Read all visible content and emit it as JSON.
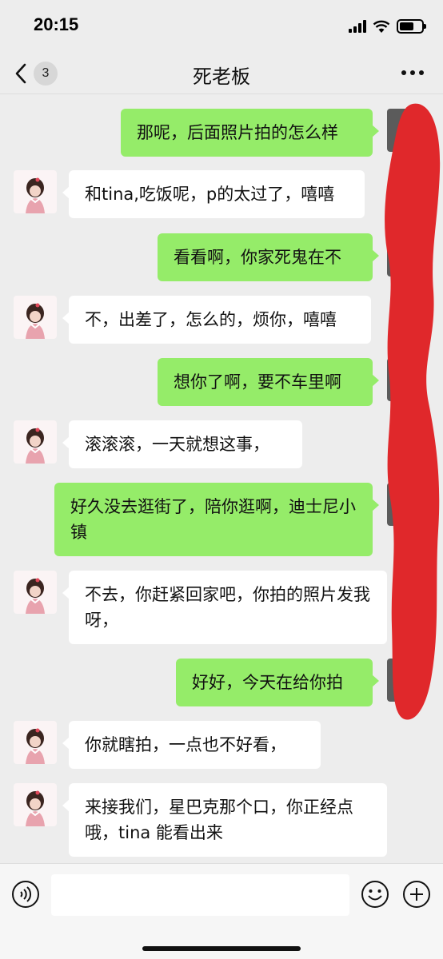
{
  "status_bar": {
    "time": "20:15"
  },
  "nav": {
    "title": "死老板",
    "unread_count": "3"
  },
  "messages": [
    {
      "side": "right",
      "text": "那呢，后面照片拍的怎么样"
    },
    {
      "side": "left",
      "text": "和tina,吃饭呢，p的太过了，嘻嘻"
    },
    {
      "side": "right",
      "text": "看看啊，你家死鬼在不"
    },
    {
      "side": "left",
      "text": "不，出差了，怎么的，烦你，嘻嘻"
    },
    {
      "side": "right",
      "text": "想你了啊，要不车里啊"
    },
    {
      "side": "left",
      "text": "滚滚滚，一天就想这事，"
    },
    {
      "side": "right",
      "text": "好久没去逛街了，陪你逛啊，迪士尼小镇"
    },
    {
      "side": "left",
      "text": "不去，你赶紧回家吧，你拍的照片发我呀，"
    },
    {
      "side": "right",
      "text": "好好，今天在给你拍"
    },
    {
      "side": "left",
      "text": "你就瞎拍，一点也不好看，"
    },
    {
      "side": "left",
      "text": "来接我们，星巴克那个口，你正经点哦，tina 能看出来"
    }
  ],
  "input": {
    "value": ""
  },
  "icons": {
    "back": "chevron-left-icon",
    "more": "more-dots-icon",
    "voice": "voice-icon",
    "emoji": "emoji-icon",
    "plus": "plus-icon"
  },
  "colors": {
    "sent_bubble": "#95ec69",
    "received_bubble": "#ffffff",
    "background": "#ededed",
    "redaction": "#e0282b"
  }
}
